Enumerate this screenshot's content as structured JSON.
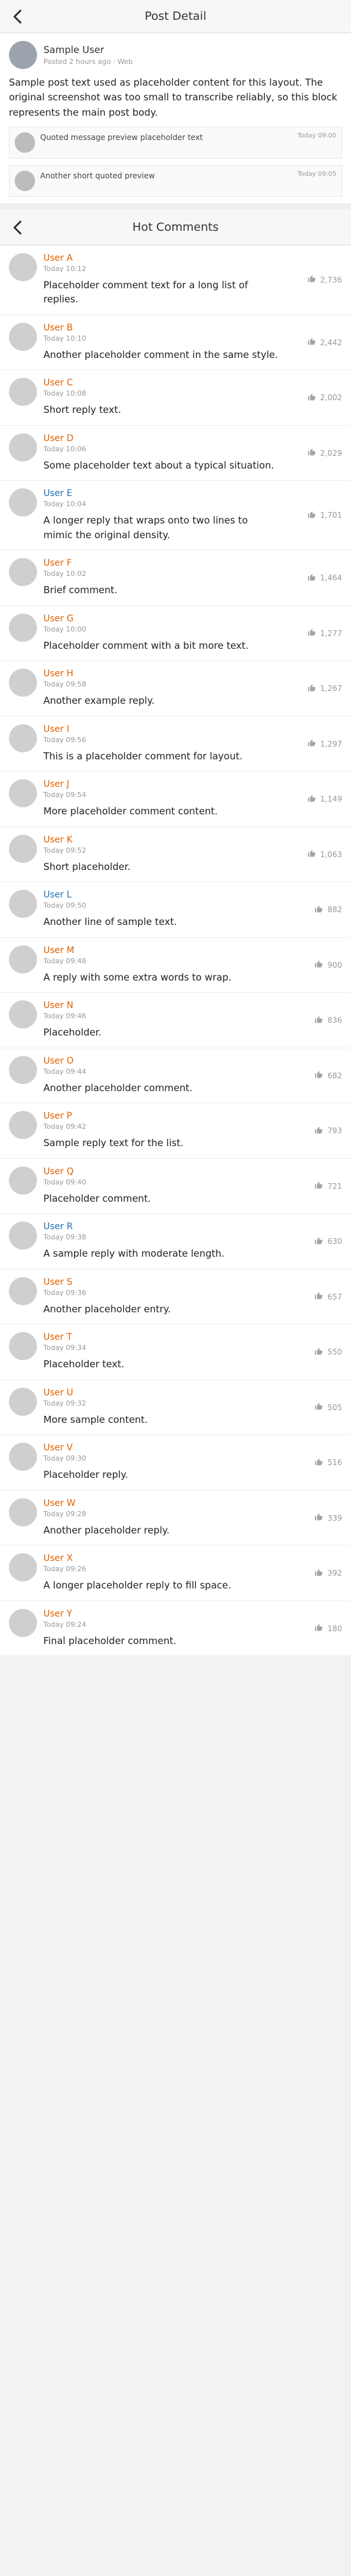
{
  "nav": {
    "title": "Post Detail"
  },
  "post": {
    "name": "Sample User",
    "meta": "Posted 2 hours ago · Web",
    "text": "Sample post text used as placeholder content for this layout. The original screenshot was too small to transcribe reliably, so this block represents the main post body.",
    "mini": [
      {
        "text": "Quoted message preview placeholder text",
        "meta": "Today 09:00"
      },
      {
        "text": "Another short quoted preview",
        "meta": "Today 09:05"
      }
    ]
  },
  "section": {
    "title": "Hot Comments"
  },
  "comments": [
    {
      "name": "User A",
      "meta": "Today 10:12",
      "text": "Placeholder comment text for a long list of replies.",
      "likes": "2,736",
      "blue": false
    },
    {
      "name": "User B",
      "meta": "Today 10:10",
      "text": "Another placeholder comment in the same style.",
      "likes": "2,442",
      "blue": false
    },
    {
      "name": "User C",
      "meta": "Today 10:08",
      "text": "Short reply text.",
      "likes": "2,002",
      "blue": false
    },
    {
      "name": "User D",
      "meta": "Today 10:06",
      "text": "Some placeholder text about a typical situation.",
      "likes": "2,029",
      "blue": false
    },
    {
      "name": "User E",
      "meta": "Today 10:04",
      "text": "A longer reply that wraps onto two lines to mimic the original density.",
      "likes": "1,701",
      "blue": true
    },
    {
      "name": "User F",
      "meta": "Today 10:02",
      "text": "Brief comment.",
      "likes": "1,464",
      "blue": false
    },
    {
      "name": "User G",
      "meta": "Today 10:00",
      "text": "Placeholder comment with a bit more text.",
      "likes": "1,277",
      "blue": false
    },
    {
      "name": "User H",
      "meta": "Today 09:58",
      "text": "Another example reply.",
      "likes": "1,267",
      "blue": false
    },
    {
      "name": "User I",
      "meta": "Today 09:56",
      "text": "This is a placeholder comment for layout.",
      "likes": "1,297",
      "blue": false
    },
    {
      "name": "User J",
      "meta": "Today 09:54",
      "text": "More placeholder comment content.",
      "likes": "1,149",
      "blue": false
    },
    {
      "name": "User K",
      "meta": "Today 09:52",
      "text": "Short placeholder.",
      "likes": "1,063",
      "blue": false
    },
    {
      "name": "User L",
      "meta": "Today 09:50",
      "text": "Another line of sample text.",
      "likes": "882",
      "blue": true
    },
    {
      "name": "User M",
      "meta": "Today 09:48",
      "text": "A reply with some extra words to wrap.",
      "likes": "900",
      "blue": false
    },
    {
      "name": "User N",
      "meta": "Today 09:46",
      "text": "Placeholder.",
      "likes": "836",
      "blue": false
    },
    {
      "name": "User O",
      "meta": "Today 09:44",
      "text": "Another placeholder comment.",
      "likes": "682",
      "blue": false
    },
    {
      "name": "User P",
      "meta": "Today 09:42",
      "text": "Sample reply text for the list.",
      "likes": "793",
      "blue": false
    },
    {
      "name": "User Q",
      "meta": "Today 09:40",
      "text": "Placeholder comment.",
      "likes": "721",
      "blue": false
    },
    {
      "name": "User R",
      "meta": "Today 09:38",
      "text": "A sample reply with moderate length.",
      "likes": "630",
      "blue": true
    },
    {
      "name": "User S",
      "meta": "Today 09:36",
      "text": "Another placeholder entry.",
      "likes": "657",
      "blue": false
    },
    {
      "name": "User T",
      "meta": "Today 09:34",
      "text": "Placeholder text.",
      "likes": "550",
      "blue": false
    },
    {
      "name": "User U",
      "meta": "Today 09:32",
      "text": "More sample content.",
      "likes": "505",
      "blue": false
    },
    {
      "name": "User V",
      "meta": "Today 09:30",
      "text": "Placeholder reply.",
      "likes": "516",
      "blue": false
    },
    {
      "name": "User W",
      "meta": "Today 09:28",
      "text": "Another placeholder reply.",
      "likes": "339",
      "blue": false
    },
    {
      "name": "User X",
      "meta": "Today 09:26",
      "text": "A longer placeholder reply to fill space.",
      "likes": "392",
      "blue": false
    },
    {
      "name": "User Y",
      "meta": "Today 09:24",
      "text": "Final placeholder comment.",
      "likes": "180",
      "blue": false
    }
  ]
}
